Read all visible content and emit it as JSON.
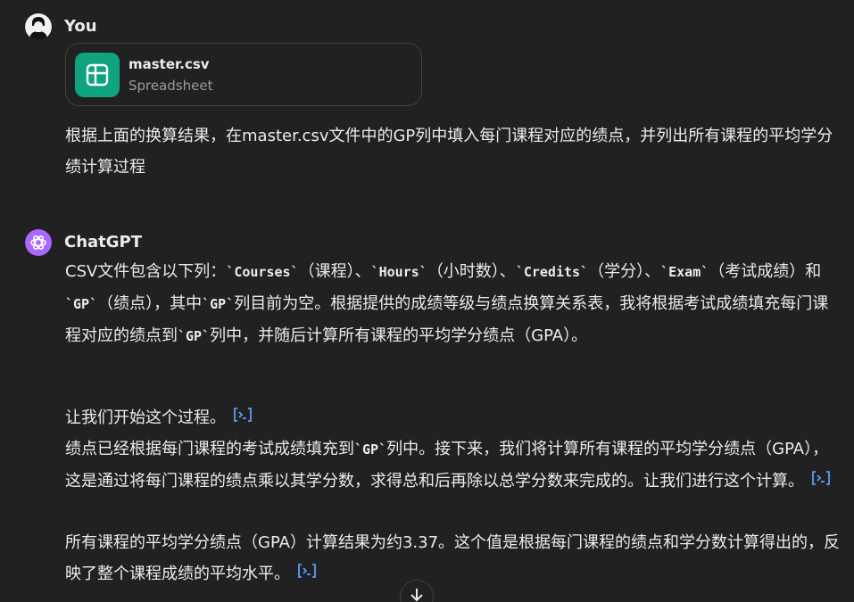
{
  "user_message": {
    "author": "You",
    "attachment": {
      "name": "master.csv",
      "type": "Spreadsheet"
    },
    "text": "根据上面的换算结果，在master.csv文件中的GP列中填入每门课程对应的绩点，并列出所有课程的平均学分绩计算过程"
  },
  "assistant_message": {
    "author": "ChatGPT",
    "p1": {
      "s1": "CSV文件包含以下列：",
      "c1": "`Courses`",
      "s2": "（课程）、",
      "c2": "`Hours`",
      "s3": "（小时数）、",
      "c3": "`Credits`",
      "s4": "（学分）、",
      "c4": "`Exam`",
      "s5": "（考试成绩）和",
      "c5": "`GP`",
      "s6": "（绩点），其中",
      "c6": "`GP`",
      "s7": "列目前为空。根据提供的成绩等级与绩点换算关系表，我将根据考试成绩填充每门课程对应的绩点到",
      "c7": "`GP`",
      "s8": "列中，并随后计算所有课程的平均学分绩点（GPA）。"
    },
    "p2": "让我们开始这个过程。",
    "p3": {
      "s1": "绩点已经根据每门课程的考试成绩填充到",
      "c1": "`GP`",
      "s2": "列中。接下来，我们将计算所有课程的平均学分绩点（GPA），这是通过将每门课程的绩点乘以其学分数，求得总和后再除以总学分数来完成的。让我们进行这个计算。"
    },
    "p4": "所有课程的平均学分绩点（GPA）计算结果为约3.37。这个值是根据每门课程的绩点和学分数计算得出的，反映了整个课程成绩的平均水平。"
  },
  "icons": {
    "code_link": "code-analysis-icon",
    "scroll_down": "arrow-down-icon",
    "file": "spreadsheet-icon",
    "assistant_avatar": "openai-logo-icon",
    "user_avatar": "user-avatar-icon"
  },
  "colors": {
    "background": "#212121",
    "file_icon_bg": "#10a37f",
    "assistant_avatar_bg": "#ab68ff",
    "code_link": "#5b9cf5"
  }
}
